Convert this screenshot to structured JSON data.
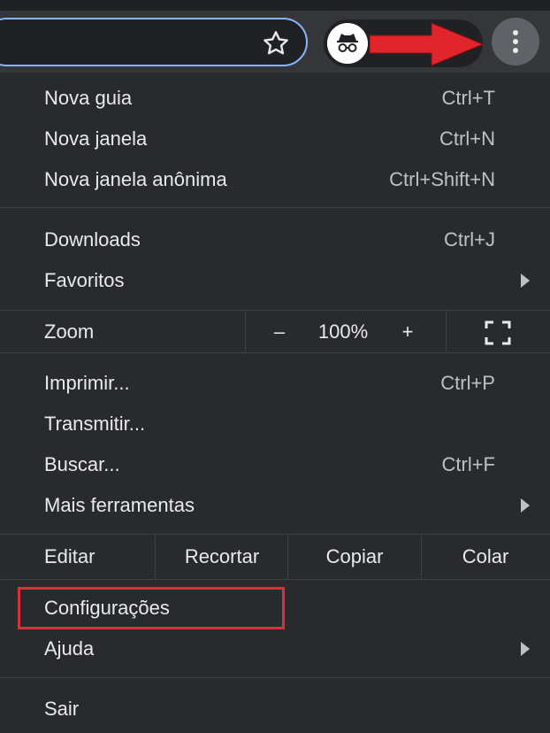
{
  "toolbar": {
    "star_icon": "star-icon",
    "profile_icon": "incognito-icon",
    "menu_icon": "kebab-menu-icon",
    "annotation_arrow_color": "#e0252c"
  },
  "menu": {
    "group1": [
      {
        "label": "Nova guia",
        "shortcut": "Ctrl+T"
      },
      {
        "label": "Nova janela",
        "shortcut": "Ctrl+N"
      },
      {
        "label": "Nova janela anônima",
        "shortcut": "Ctrl+Shift+N"
      }
    ],
    "group2": [
      {
        "label": "Downloads",
        "shortcut": "Ctrl+J"
      },
      {
        "label": "Favoritos",
        "shortcut": ""
      }
    ],
    "zoom": {
      "label": "Zoom",
      "minus": "–",
      "value": "100%",
      "plus": "+"
    },
    "group3": [
      {
        "label": "Imprimir...",
        "shortcut": "Ctrl+P"
      },
      {
        "label": "Transmitir...",
        "shortcut": ""
      },
      {
        "label": "Buscar...",
        "shortcut": "Ctrl+F"
      },
      {
        "label": "Mais ferramentas",
        "shortcut": ""
      }
    ],
    "edit": {
      "label": "Editar",
      "cut": "Recortar",
      "copy": "Copiar",
      "paste": "Colar"
    },
    "group4": [
      {
        "label": "Configurações",
        "shortcut": ""
      },
      {
        "label": "Ajuda",
        "shortcut": ""
      }
    ],
    "exit": {
      "label": "Sair"
    }
  },
  "annotation": {
    "highlight_color": "#d9303a"
  }
}
